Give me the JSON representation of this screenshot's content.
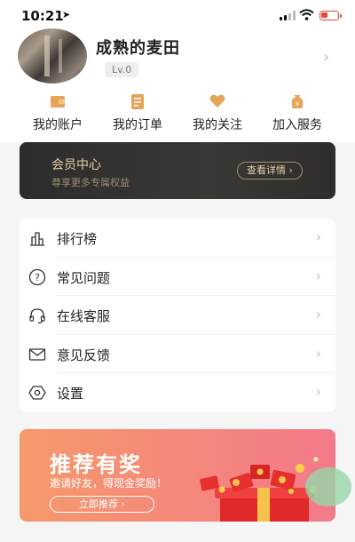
{
  "status_bar": {
    "time": "10:21",
    "battery_percent": 40
  },
  "profile": {
    "username": "成熟的麦田",
    "level": "Lv.0"
  },
  "quick_nav": [
    {
      "label": "我的账户",
      "icon": "wallet-icon"
    },
    {
      "label": "我的订单",
      "icon": "order-icon"
    },
    {
      "label": "我的关注",
      "icon": "heart-icon"
    },
    {
      "label": "加入服务",
      "icon": "service-icon"
    }
  ],
  "member": {
    "title": "会员中心",
    "subtitle": "尊享更多专属权益",
    "button": "查看详情 ›"
  },
  "menu": [
    {
      "label": "排行榜",
      "icon": "ranking-icon"
    },
    {
      "label": "常见问题",
      "icon": "question-icon"
    },
    {
      "label": "在线客服",
      "icon": "headset-icon"
    },
    {
      "label": "意见反馈",
      "icon": "mail-icon"
    },
    {
      "label": "设置",
      "icon": "settings-icon"
    }
  ],
  "promo": {
    "title": "推荐有奖",
    "subtitle": "邀请好友，得现金奖励！",
    "button": "立即推荐 ›"
  },
  "colors": {
    "accent": "#e8a35a",
    "member_gold": "#e8cfa6",
    "promo_start": "#f59a6b",
    "promo_end": "#f47a8a"
  }
}
